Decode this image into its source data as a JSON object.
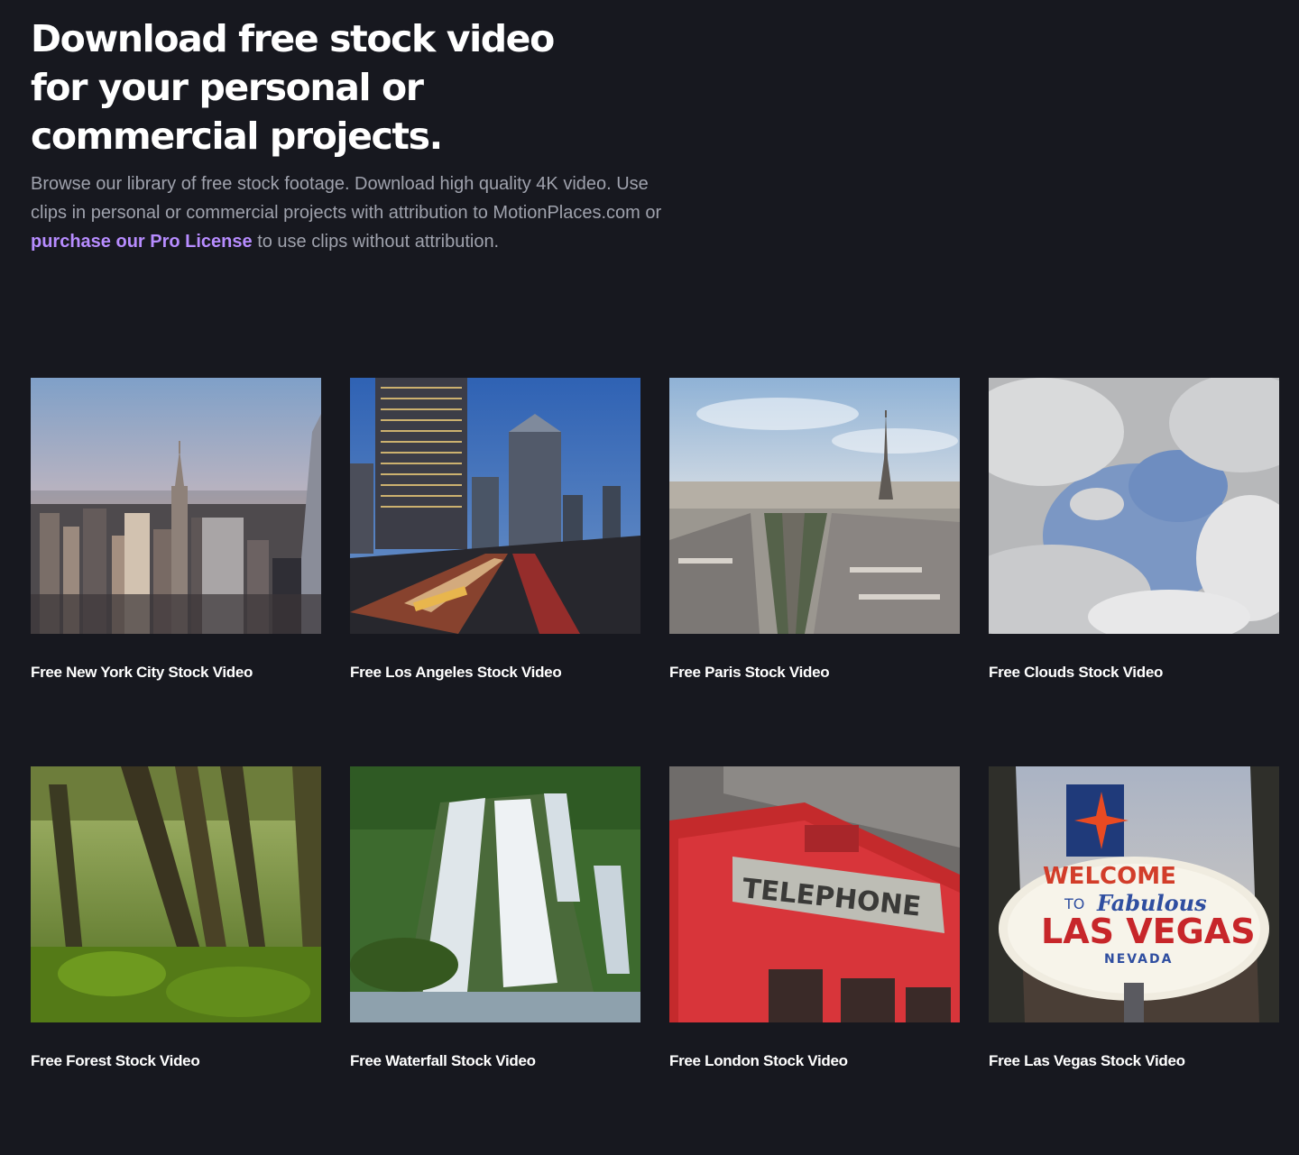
{
  "hero": {
    "title": "Download free stock video for your personal or commercial projects.",
    "description_before_link": "Browse our library of free stock footage. Download high quality 4K video. Use clips in personal or commercial projects with attribution to MotionPlaces.com or ",
    "link_label": "purchase our Pro License",
    "description_after_link": " to use clips without attribution.",
    "link_color": "#b78cff"
  },
  "cards": [
    {
      "title": "Free New York City Stock Video",
      "thumbnail_icon": "new-york-city-skyline-image"
    },
    {
      "title": "Free Los Angeles Stock Video",
      "thumbnail_icon": "los-angeles-highway-image"
    },
    {
      "title": "Free Paris Stock Video",
      "thumbnail_icon": "paris-eiffel-tower-image"
    },
    {
      "title": "Free Clouds Stock Video",
      "thumbnail_icon": "clouds-sky-image"
    },
    {
      "title": "Free Forest Stock Video",
      "thumbnail_icon": "forest-trees-image"
    },
    {
      "title": "Free Waterfall Stock Video",
      "thumbnail_icon": "waterfall-image"
    },
    {
      "title": "Free London Stock Video",
      "thumbnail_icon": "london-telephone-box-image"
    },
    {
      "title": "Free Las Vegas Stock Video",
      "thumbnail_icon": "las-vegas-sign-image"
    }
  ],
  "thumbnail_text": {
    "telephone": "TELEPHONE",
    "vegas_welcome": "WELCOME",
    "vegas_to": "TO",
    "vegas_fabulous": "Fabulous",
    "vegas_city": "LAS VEGAS",
    "vegas_state": "NEVADA"
  },
  "colors": {
    "background": "#17181f",
    "heading": "#ffffff",
    "body_text": "#9fa2ad"
  }
}
